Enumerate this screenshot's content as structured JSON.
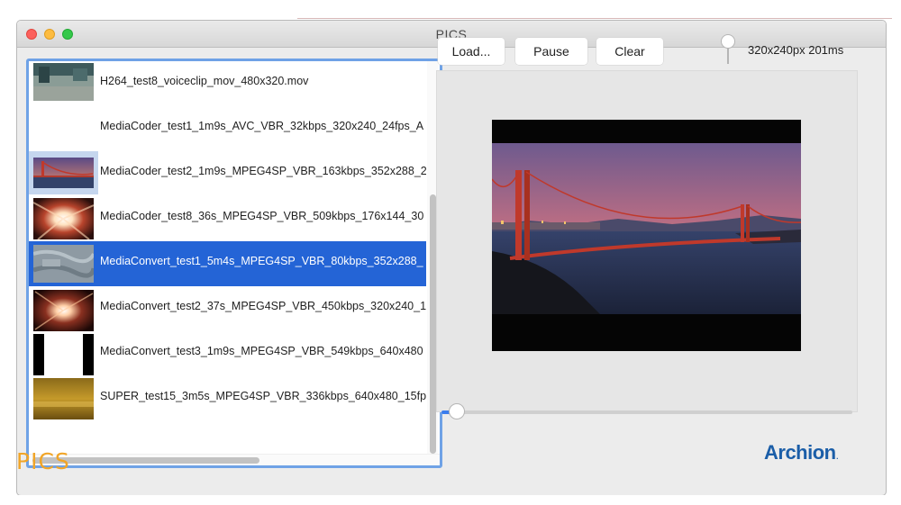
{
  "window": {
    "title": "PICS"
  },
  "file_list": {
    "items": [
      {
        "label": "H264_test8_voiceclip_mov_480x320.mov",
        "thumb": "street-scene-thumbnail",
        "selected": false
      },
      {
        "label": "MediaCoder_test1_1m9s_AVC_VBR_32kbps_320x240_24fps_A",
        "thumb": "blank-thumbnail",
        "selected": false
      },
      {
        "label": "MediaCoder_test2_1m9s_MPEG4SP_VBR_163kbps_352x288_2",
        "thumb": "bridge-thumbnail",
        "selected": false
      },
      {
        "label": "MediaCoder_test8_36s_MPEG4SP_VBR_509kbps_176x144_30",
        "thumb": "light-burst-thumbnail",
        "selected": false
      },
      {
        "label": "MediaConvert_test1_5m4s_MPEG4SP_VBR_80kbps_352x288_",
        "thumb": "gray-texture-thumbnail",
        "selected": true
      },
      {
        "label": "MediaConvert_test2_37s_MPEG4SP_VBR_450kbps_320x240_1",
        "thumb": "light-burst-thumbnail",
        "selected": false
      },
      {
        "label": "MediaConvert_test3_1m9s_MPEG4SP_VBR_549kbps_640x480",
        "thumb": "white-frame-thumbnail",
        "selected": false
      },
      {
        "label": "SUPER_test15_3m5s_MPEG4SP_VBR_336kbps_640x480_15fp",
        "thumb": "amber-thumbnail",
        "selected": false
      }
    ]
  },
  "toolbar": {
    "load_label": "Load...",
    "pause_label": "Pause",
    "clear_label": "Clear",
    "size_readout": "320x240px 201ms"
  },
  "preview": {
    "image": "golden-gate-bridge-sunset",
    "seek_position": 0.03
  },
  "branding": {
    "left_logo": "PICS",
    "right_logo": "Archion",
    "right_logo_mark": "."
  },
  "colors": {
    "selection": "#2464d6",
    "focus_ring": "#6fa2e6",
    "pics_logo": "#f1a527",
    "archion_logo": "#1b5ea8"
  }
}
